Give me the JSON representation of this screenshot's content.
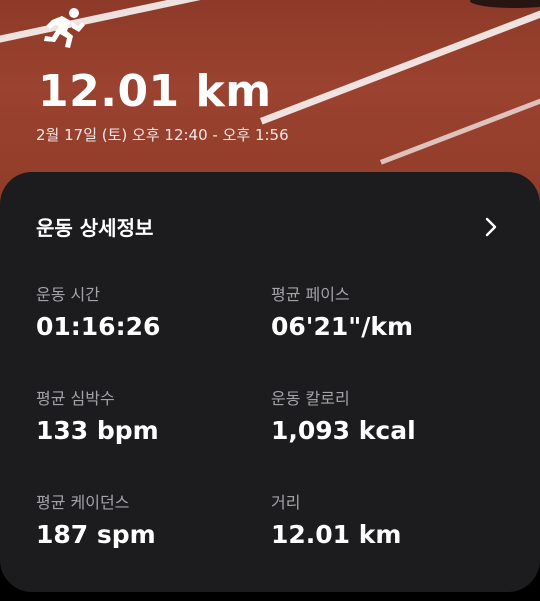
{
  "hero": {
    "icon": "running-person-icon",
    "distance": "12.01 km",
    "date_range": "2월 17일 (토) 오후 12:40 - 오후 1:56",
    "colors": {
      "track": "#9b4230",
      "lane_line": "#ffffff"
    }
  },
  "details": {
    "title": "운동 상세정보",
    "expand_icon": "chevron-right-icon",
    "stats": [
      {
        "label": "운동 시간",
        "value": "01:16:26"
      },
      {
        "label": "평균 페이스",
        "value": "06'21\"/km"
      },
      {
        "label": "평균 심박수",
        "value": "133 bpm"
      },
      {
        "label": "운동 칼로리",
        "value": "1,093 kcal"
      },
      {
        "label": "평균 케이던스",
        "value": "187 spm"
      },
      {
        "label": "거리",
        "value": "12.01 km"
      }
    ],
    "colors": {
      "card_background": "#1c1c1e",
      "label": "#a3a3a8",
      "value": "#ffffff"
    }
  }
}
